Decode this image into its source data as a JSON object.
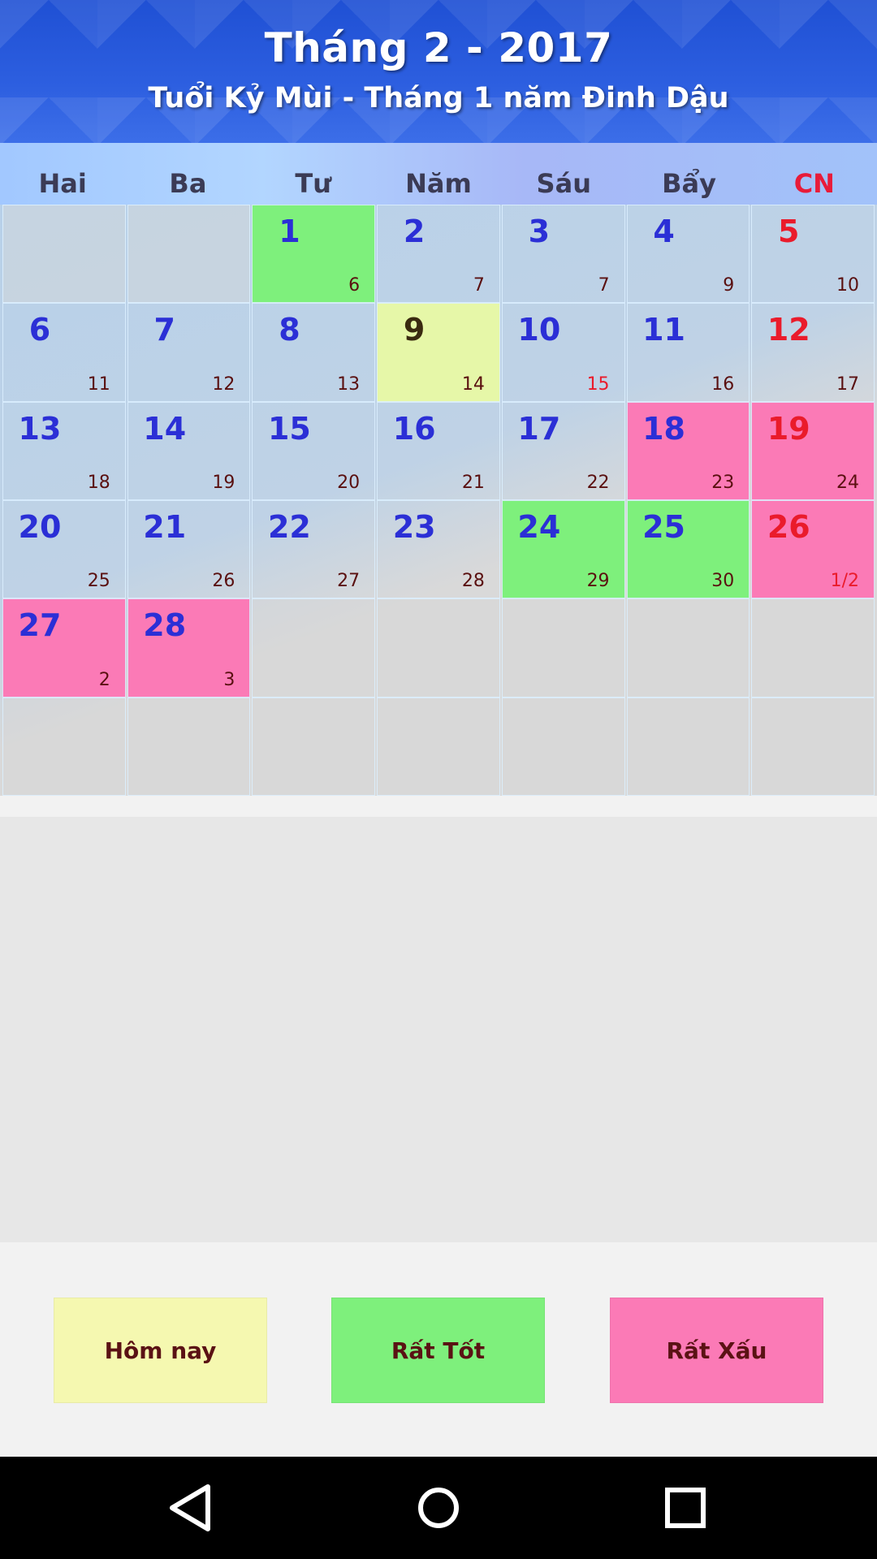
{
  "header": {
    "title": "Tháng 2 - 2017",
    "subtitle": "Tuổi Kỷ Mùi - Tháng 1 năm Đinh Dậu"
  },
  "weekdays": [
    "Hai",
    "Ba",
    "Tư",
    "Năm",
    "Sáu",
    "Bẩy",
    "CN"
  ],
  "calendar": {
    "cells": [
      {
        "day": "",
        "lunar": "",
        "type": "empty"
      },
      {
        "day": "",
        "lunar": "",
        "type": "empty"
      },
      {
        "day": "1",
        "lunar": "6",
        "type": "good"
      },
      {
        "day": "2",
        "lunar": "7",
        "type": "normal"
      },
      {
        "day": "3",
        "lunar": "7",
        "type": "normal"
      },
      {
        "day": "4",
        "lunar": "9",
        "type": "normal"
      },
      {
        "day": "5",
        "lunar": "10",
        "type": "normal",
        "sunday": true
      },
      {
        "day": "6",
        "lunar": "11",
        "type": "normal"
      },
      {
        "day": "7",
        "lunar": "12",
        "type": "normal"
      },
      {
        "day": "8",
        "lunar": "13",
        "type": "normal"
      },
      {
        "day": "9",
        "lunar": "14",
        "type": "today"
      },
      {
        "day": "10",
        "lunar": "15",
        "type": "normal",
        "lunar_red": true
      },
      {
        "day": "11",
        "lunar": "16",
        "type": "normal"
      },
      {
        "day": "12",
        "lunar": "17",
        "type": "normal",
        "sunday": true
      },
      {
        "day": "13",
        "lunar": "18",
        "type": "normal"
      },
      {
        "day": "14",
        "lunar": "19",
        "type": "normal"
      },
      {
        "day": "15",
        "lunar": "20",
        "type": "normal"
      },
      {
        "day": "16",
        "lunar": "21",
        "type": "normal"
      },
      {
        "day": "17",
        "lunar": "22",
        "type": "normal"
      },
      {
        "day": "18",
        "lunar": "23",
        "type": "bad"
      },
      {
        "day": "19",
        "lunar": "24",
        "type": "bad",
        "sunday": true
      },
      {
        "day": "20",
        "lunar": "25",
        "type": "normal"
      },
      {
        "day": "21",
        "lunar": "26",
        "type": "normal"
      },
      {
        "day": "22",
        "lunar": "27",
        "type": "normal"
      },
      {
        "day": "23",
        "lunar": "28",
        "type": "normal"
      },
      {
        "day": "24",
        "lunar": "29",
        "type": "good"
      },
      {
        "day": "25",
        "lunar": "30",
        "type": "good"
      },
      {
        "day": "26",
        "lunar": "1/2",
        "type": "bad",
        "sunday": true,
        "lunar_red": true
      },
      {
        "day": "27",
        "lunar": "2",
        "type": "bad"
      },
      {
        "day": "28",
        "lunar": "3",
        "type": "bad"
      },
      {
        "day": "",
        "lunar": "",
        "type": "empty"
      },
      {
        "day": "",
        "lunar": "",
        "type": "empty"
      },
      {
        "day": "",
        "lunar": "",
        "type": "empty"
      },
      {
        "day": "",
        "lunar": "",
        "type": "empty"
      },
      {
        "day": "",
        "lunar": "",
        "type": "empty"
      },
      {
        "day": "",
        "lunar": "",
        "type": "empty"
      },
      {
        "day": "",
        "lunar": "",
        "type": "empty"
      },
      {
        "day": "",
        "lunar": "",
        "type": "empty"
      },
      {
        "day": "",
        "lunar": "",
        "type": "empty"
      },
      {
        "day": "",
        "lunar": "",
        "type": "empty"
      },
      {
        "day": "",
        "lunar": "",
        "type": "empty"
      },
      {
        "day": "",
        "lunar": "",
        "type": "empty"
      }
    ]
  },
  "legend": {
    "today_label": "Hôm nay",
    "good_label": "Rất Tốt",
    "bad_label": "Rất Xấu"
  },
  "colors": {
    "header_blue": "#2d5fe0",
    "today": "#e6f7a8",
    "good": "#7ef07c",
    "bad": "#fb7ab6",
    "day_number": "#2b2fd6",
    "sunday": "#ea1b2b"
  },
  "navbar": {
    "back_icon": "back-triangle-icon",
    "home_icon": "home-circle-icon",
    "recent_icon": "recent-square-icon"
  }
}
